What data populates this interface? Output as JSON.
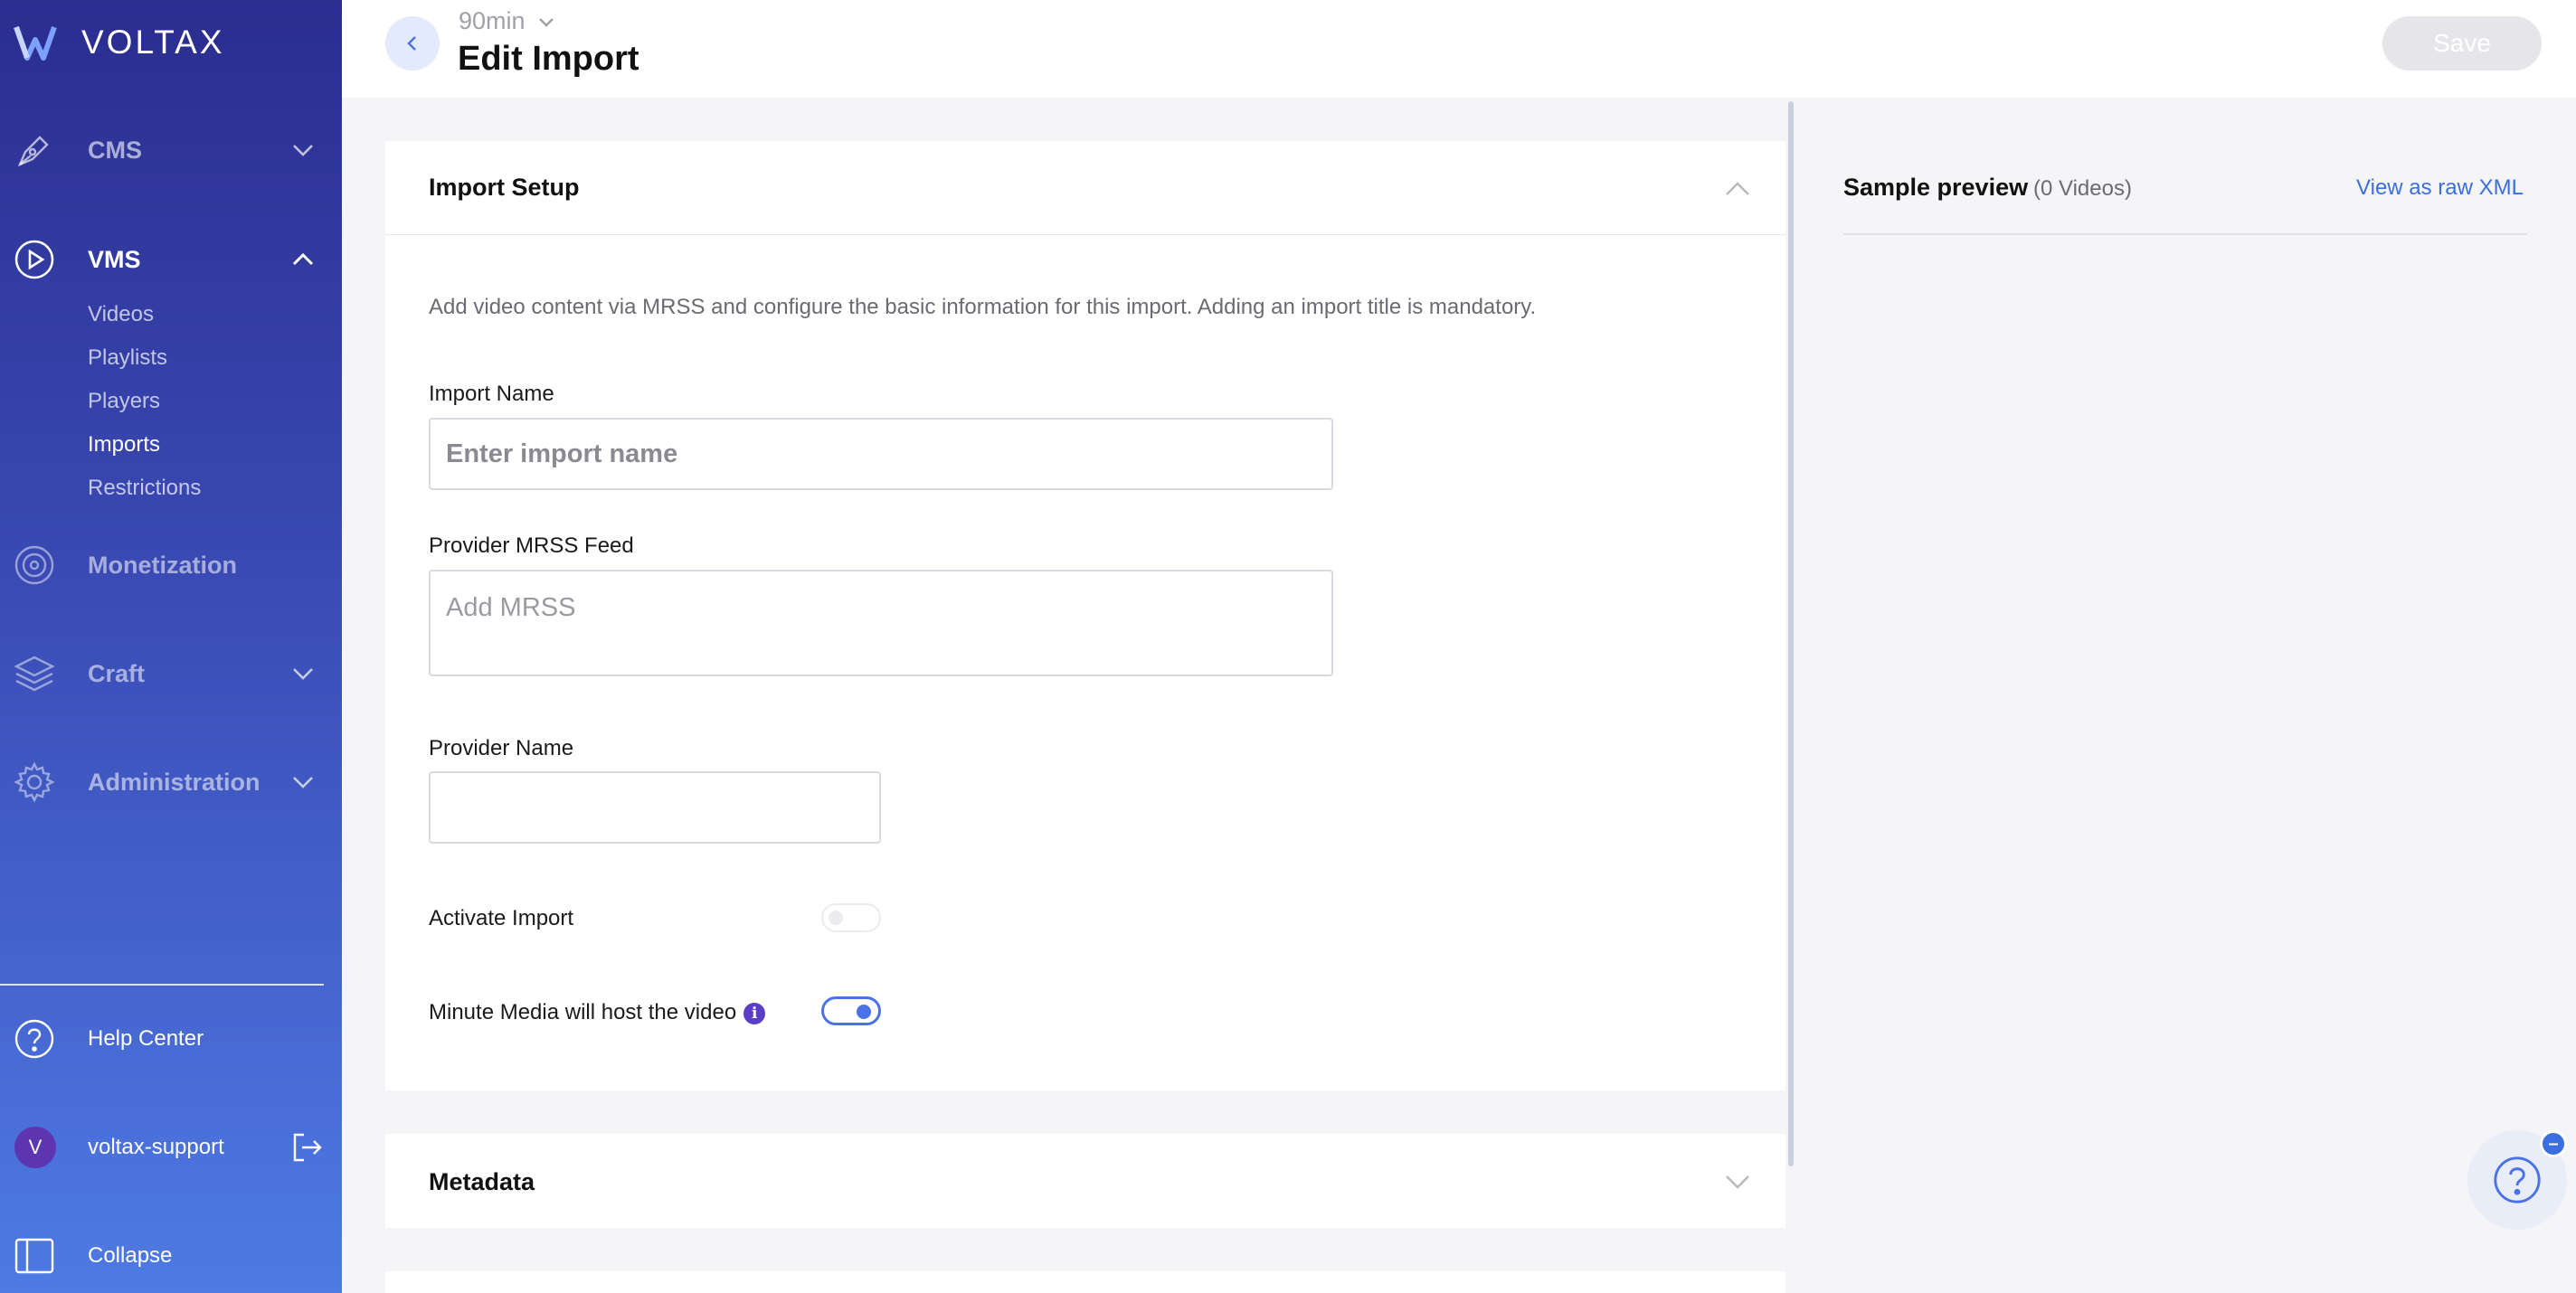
{
  "brand": {
    "name": "VOLTAX"
  },
  "sidebar": {
    "nav": [
      {
        "label": "CMS",
        "icon": "pen-nib-icon",
        "expanded": false
      },
      {
        "label": "VMS",
        "icon": "play-circle-icon",
        "expanded": true
      },
      {
        "label": "Monetization",
        "icon": "target-icon"
      },
      {
        "label": "Craft",
        "icon": "layers-icon",
        "expanded": false
      },
      {
        "label": "Administration",
        "icon": "gear-icon",
        "expanded": false
      }
    ],
    "vms_items": [
      {
        "label": "Videos"
      },
      {
        "label": "Playlists"
      },
      {
        "label": "Players"
      },
      {
        "label": "Imports",
        "active": true
      },
      {
        "label": "Restrictions"
      }
    ],
    "help_center": "Help Center",
    "user": {
      "initial": "V",
      "name": "voltax-support"
    },
    "collapse": "Collapse"
  },
  "header": {
    "org": "90min",
    "title": "Edit Import",
    "save_label": "Save"
  },
  "import_setup": {
    "title": "Import Setup",
    "description": "Add video content via MRSS and configure the basic information for this import. Adding an import title is mandatory.",
    "import_name_label": "Import Name",
    "import_name_placeholder": "Enter import name",
    "mrss_label": "Provider MRSS Feed",
    "mrss_placeholder": "Add MRSS",
    "provider_name_label": "Provider Name",
    "provider_name_value": "",
    "activate_label": "Activate Import",
    "activate_on": false,
    "host_label": "Minute Media will host the video",
    "host_on": true
  },
  "metadata": {
    "title": "Metadata"
  },
  "preview": {
    "title": "Sample preview",
    "count": "(0 Videos)",
    "raw_xml_link": "View as raw XML"
  },
  "colors": {
    "accent": "#4a72e6",
    "link": "#3b6ee0",
    "info": "#5b3ec8",
    "sidebar_top": "#2b2d8f",
    "sidebar_bottom": "#4f7ae3"
  }
}
